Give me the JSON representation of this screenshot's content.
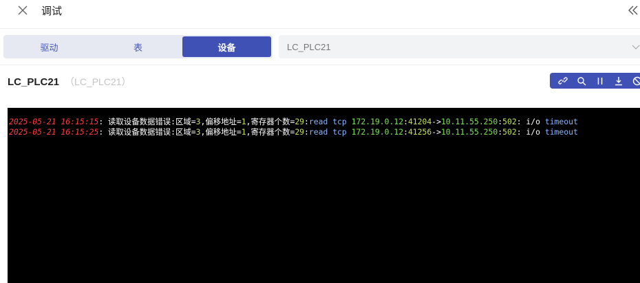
{
  "header": {
    "title": "调试",
    "close_icon": "close-icon",
    "collapse_icon": "double-chevron-left-icon"
  },
  "tabs": [
    {
      "label": "驱动",
      "active": false
    },
    {
      "label": "表",
      "active": false
    },
    {
      "label": "设备",
      "active": true
    }
  ],
  "device_select": {
    "value": "LC_PLC21"
  },
  "device": {
    "name": "LC_PLC21",
    "sub": "（LC_PLC21）"
  },
  "toolbar": {
    "icons": [
      "link-icon",
      "search-icon",
      "pause-icon",
      "download-icon",
      "clear-icon"
    ]
  },
  "logs": [
    {
      "ts": "2025-05-21 16:15:15",
      "sep1": ": 读取设备数据错误:区域=",
      "area": "3",
      "sep2": ",偏移地址=",
      "offset": "1",
      "sep3": ",寄存器个数=",
      "count": "29",
      "sep4": ":",
      "op": "read",
      "proto": "tcp",
      "src_ip": "172.19.0.12",
      "colon1": ":",
      "src_port": "41204",
      "arrow": "->",
      "dst_ip": "10.11.55.250",
      "colon2": ":",
      "dst_port": "502",
      "err": ": i/o",
      "err_kw": "timeout"
    },
    {
      "ts": "2025-05-21 16:15:25",
      "sep1": ": 读取设备数据错误:区域=",
      "area": "3",
      "sep2": ",偏移地址=",
      "offset": "1",
      "sep3": ",寄存器个数=",
      "count": "29",
      "sep4": ":",
      "op": "read",
      "proto": "tcp",
      "src_ip": "172.19.0.12",
      "colon1": ":",
      "src_port": "41256",
      "arrow": "->",
      "dst_ip": "10.11.55.250",
      "colon2": ":",
      "dst_port": "502",
      "err": ": i/o",
      "err_kw": "timeout"
    }
  ],
  "colors": {
    "accent": "#3f51b5",
    "timestamp": "#ff3b3b",
    "number": "#c3e05a",
    "keyword": "#8ab4ff",
    "ip": "#7fe05a"
  }
}
